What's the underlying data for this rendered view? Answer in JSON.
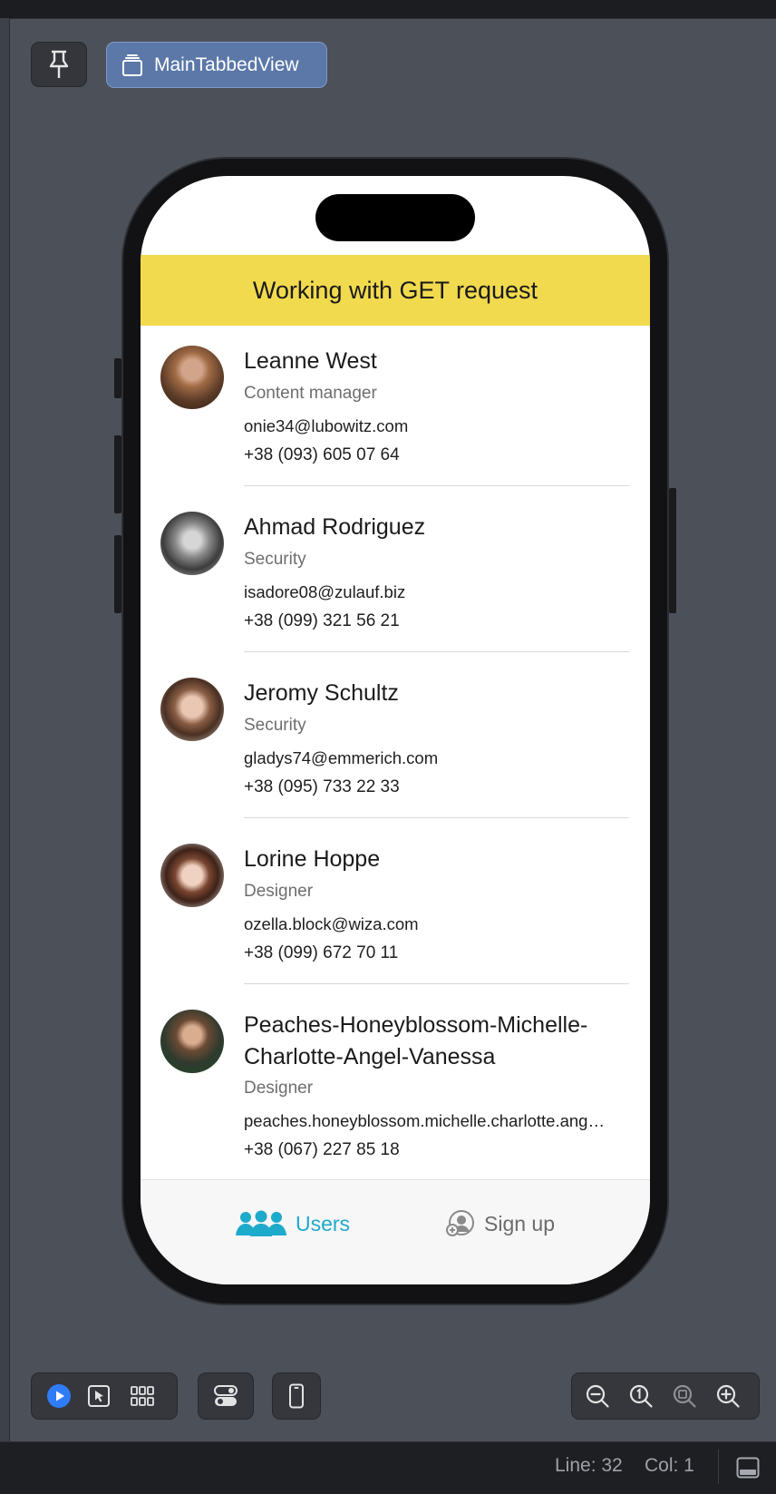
{
  "toolbar": {
    "view_label": "MainTabbedView",
    "pin_icon": "pin-icon",
    "view_icon": "stack-icon"
  },
  "app": {
    "header_title": "Working with GET request",
    "users": [
      {
        "name": "Leanne West",
        "position": "Content manager",
        "email": "onie34@lubowitz.com",
        "phone": "+38 (093) 605 07 64"
      },
      {
        "name": "Ahmad Rodriguez",
        "position": "Security",
        "email": "isadore08@zulauf.biz",
        "phone": "+38 (099) 321 56 21"
      },
      {
        "name": "Jeromy Schultz",
        "position": "Security",
        "email": "gladys74@emmerich.com",
        "phone": "+38 (095) 733 22 33"
      },
      {
        "name": "Lorine Hoppe",
        "position": "Designer",
        "email": "ozella.block@wiza.com",
        "phone": "+38 (099) 672 70 11"
      },
      {
        "name": "Peaches-Honeyblossom-Michelle-Charlotte-Angel-Vanessa",
        "position": "Designer",
        "email": "peaches.honeyblossom.michelle.charlotte.angel.vanessa@example.com",
        "phone": "+38 (067) 227 85 18"
      }
    ],
    "tabs": {
      "users_label": "Users",
      "signup_label": "Sign up"
    }
  },
  "statusbar": {
    "line": "Line: 32",
    "col": "Col: 1"
  },
  "colors": {
    "accent": "#1eaacb",
    "header_bg": "#f2da4e",
    "selected_tool": "#5b78a8"
  }
}
